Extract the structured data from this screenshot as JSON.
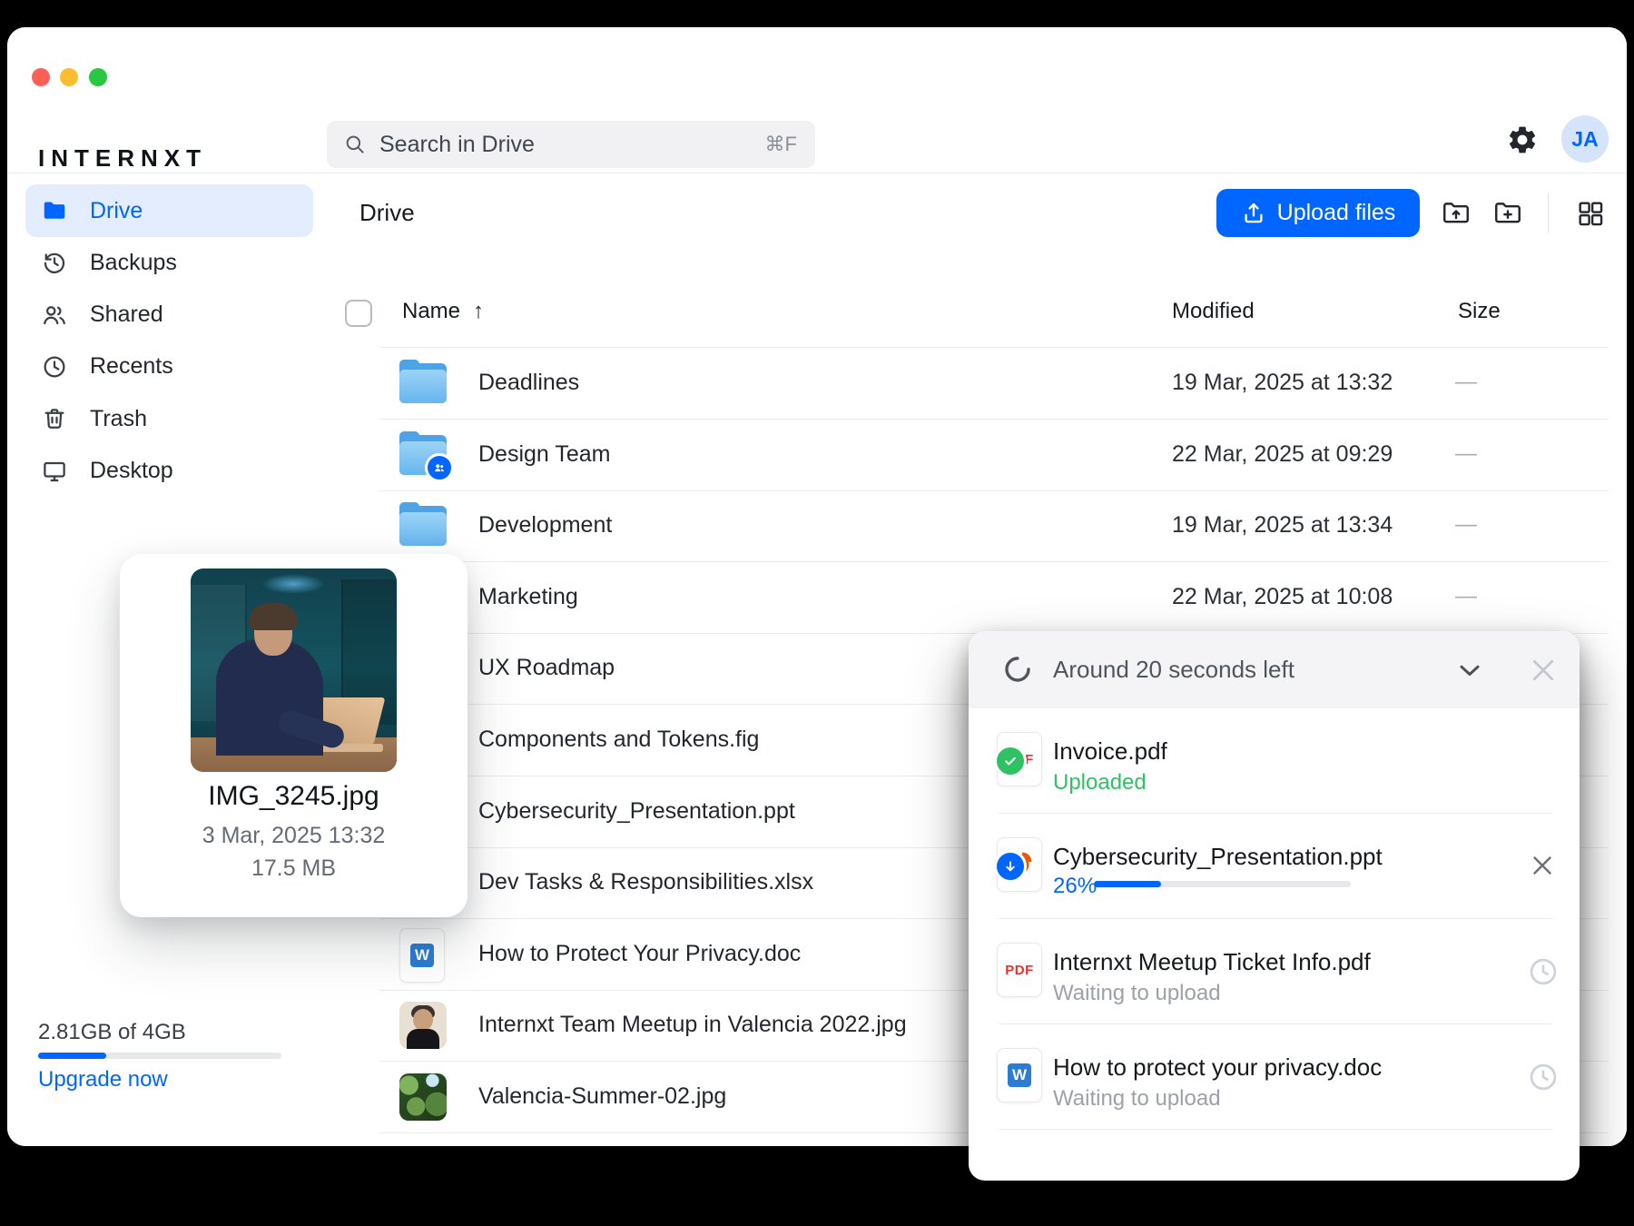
{
  "colors": {
    "primary": "#0066ff",
    "success": "#2fc264",
    "pdf_red": "#e5322d",
    "ppt_orange": "#e8590c",
    "word_blue": "#2b7cd3",
    "traffic": [
      "#ff5f57",
      "#febc2e",
      "#28c840"
    ]
  },
  "brand": {
    "logo": "INTERNXT"
  },
  "search": {
    "placeholder": "Search in Drive",
    "shortcut": "⌘F",
    "icon": "search-icon"
  },
  "header": {
    "settings_icon": "gear-icon",
    "avatar_initials": "JA"
  },
  "sidebar": {
    "items": [
      {
        "label": "Drive",
        "icon": "folder-icon",
        "active": true
      },
      {
        "label": "Backups",
        "icon": "history-icon",
        "active": false
      },
      {
        "label": "Shared",
        "icon": "people-icon",
        "active": false
      },
      {
        "label": "Recents",
        "icon": "clock-icon",
        "active": false
      },
      {
        "label": "Trash",
        "icon": "trash-icon",
        "active": false
      },
      {
        "label": "Desktop",
        "icon": "monitor-icon",
        "active": false
      }
    ],
    "storage": {
      "usage": "2.81GB of 4GB",
      "percent": 28,
      "upgrade_label": "Upgrade now"
    }
  },
  "main": {
    "title": "Drive",
    "upload_button_label": "Upload files",
    "toolbar_icons": [
      "upload-folder-icon",
      "new-folder-icon",
      "grid-view-icon"
    ],
    "columns": {
      "name": "Name",
      "sort": "↑",
      "modified": "Modified",
      "size": "Size"
    },
    "rows": [
      {
        "name": "Deadlines",
        "icon": "folder",
        "modified": "19 Mar, 2025 at 13:32",
        "size": "—"
      },
      {
        "name": "Design Team",
        "icon": "folder-shared",
        "modified": "22 Mar, 2025 at 09:29",
        "size": "—"
      },
      {
        "name": "Development",
        "icon": "folder",
        "modified": "19 Mar, 2025 at 13:34",
        "size": "—"
      },
      {
        "name": "Marketing",
        "icon": "none",
        "modified": "22 Mar, 2025 at 10:08",
        "size": "—"
      },
      {
        "name": "UX Roadmap",
        "icon": "none",
        "modified": "",
        "size": ""
      },
      {
        "name": "Components and Tokens.fig",
        "icon": "none",
        "modified": "",
        "size": ""
      },
      {
        "name": "Cybersecurity_Presentation.ppt",
        "icon": "none",
        "modified": "",
        "size": ""
      },
      {
        "name": "Dev Tasks & Responsibilities.xlsx",
        "icon": "none",
        "modified": "",
        "size": ""
      },
      {
        "name": "How to Protect Your Privacy.doc",
        "icon": "doc-word",
        "modified": "",
        "size": ""
      },
      {
        "name": "Internxt Team Meetup in Valencia 2022.jpg",
        "icon": "image-portrait",
        "modified": "",
        "size": ""
      },
      {
        "name": "Valencia-Summer-02.jpg",
        "icon": "image-foliage",
        "modified": "",
        "size": ""
      }
    ]
  },
  "preview_card": {
    "filename": "IMG_3245.jpg",
    "date": "3 Mar, 2025 13:32",
    "size": "17.5 MB"
  },
  "upload_panel": {
    "status": "Around 20 seconds left",
    "minimize_icon": "chevron-down-icon",
    "close_icon": "close-icon",
    "items": [
      {
        "name": "Invoice.pdf",
        "type": "pdf",
        "state": "done",
        "status": "Uploaded"
      },
      {
        "name": "Cybersecurity_Presentation.ppt",
        "type": "ppt",
        "state": "uploading",
        "status": "26%",
        "progress": 26,
        "action": "cancel"
      },
      {
        "name": "Internxt Meetup Ticket Info.pdf",
        "type": "pdf",
        "state": "waiting",
        "status": "Waiting to upload"
      },
      {
        "name": "How to protect your privacy.doc",
        "type": "doc",
        "state": "waiting",
        "status": "Waiting to upload"
      }
    ]
  }
}
